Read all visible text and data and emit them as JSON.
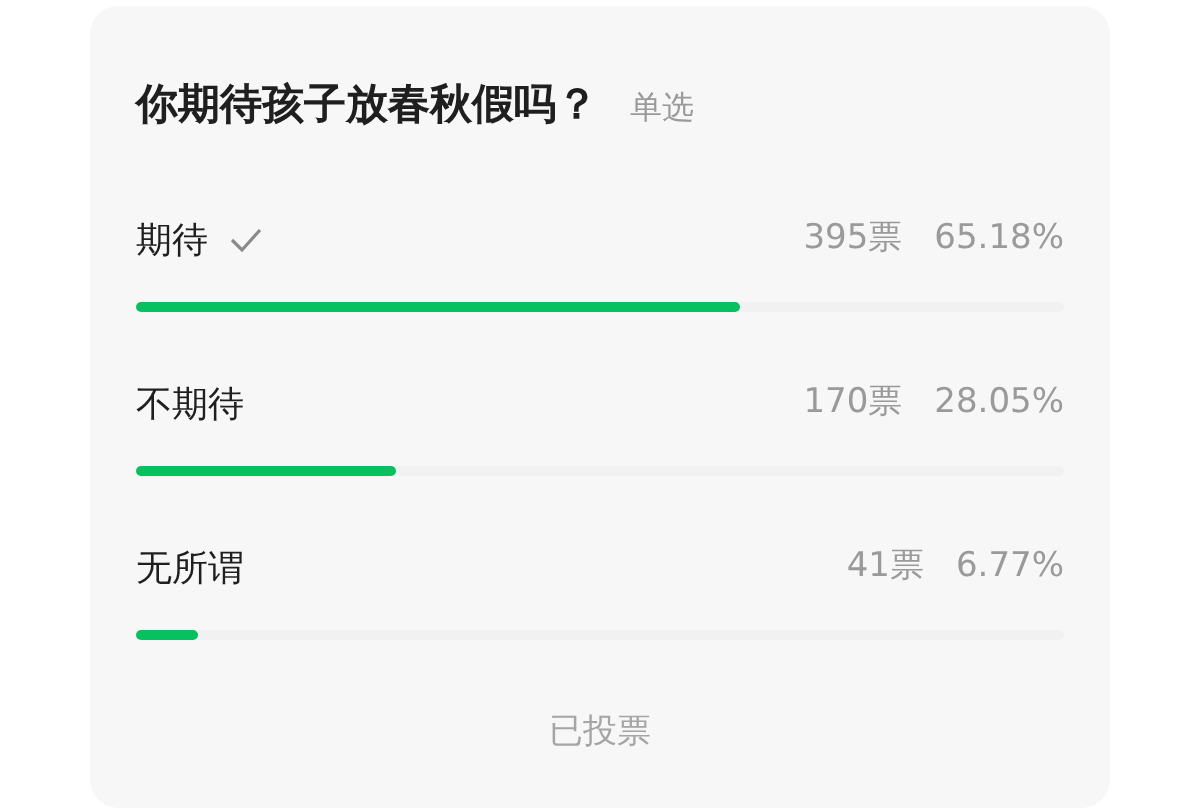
{
  "poll": {
    "title": "你期待孩子放春秋假吗？",
    "type_label": "单选",
    "options": [
      {
        "label": "期待",
        "selected": true,
        "votes": "395票",
        "percent": "65.18%",
        "level": 0.6518
      },
      {
        "label": "不期待",
        "selected": false,
        "votes": "170票",
        "percent": "28.05%",
        "level": 0.2805
      },
      {
        "label": "无所谓",
        "selected": false,
        "votes": "41票",
        "percent": "6.77%",
        "level": 0.0677
      }
    ],
    "footer": "已投票"
  }
}
